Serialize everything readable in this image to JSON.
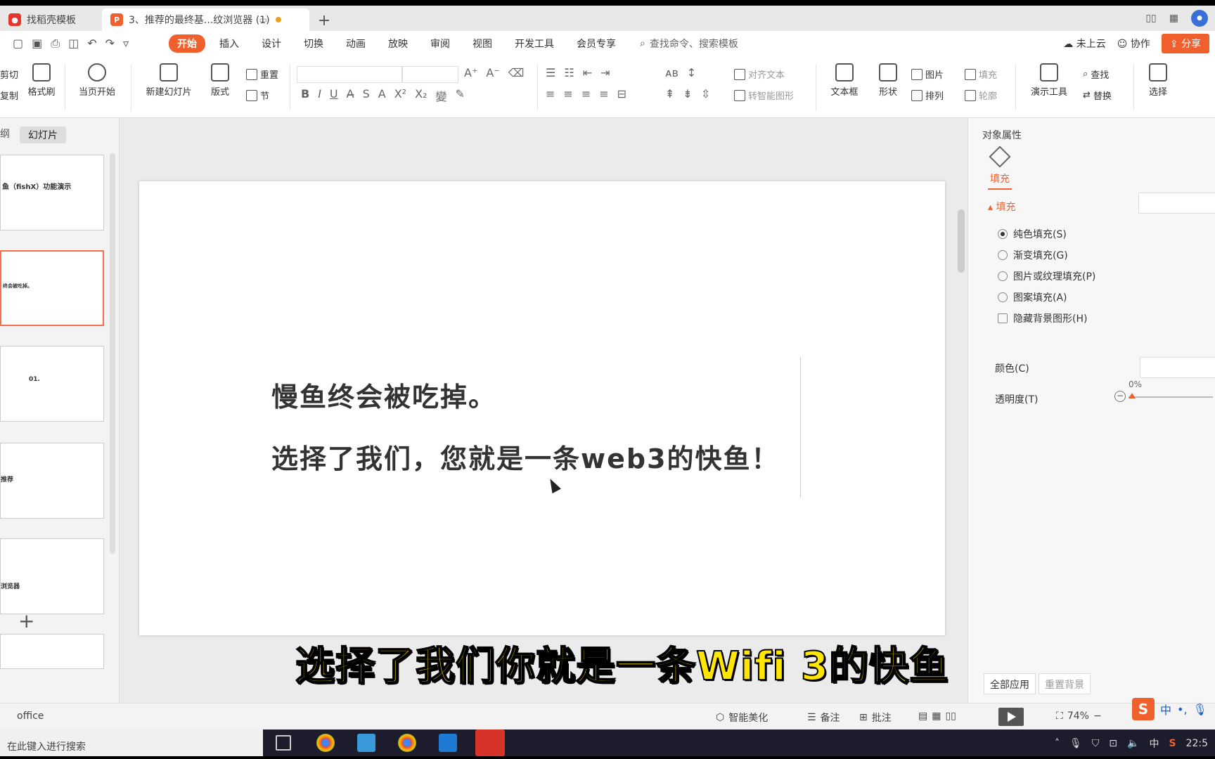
{
  "tabs": [
    {
      "label": "找稻壳模板"
    },
    {
      "label": "3、推荐的最终基...纹浏览器 (1)"
    }
  ],
  "menu": {
    "items": [
      "开始",
      "插入",
      "设计",
      "切换",
      "动画",
      "放映",
      "审阅",
      "视图",
      "开发工具",
      "会员专享"
    ],
    "search": "查找命令、搜索模板",
    "cloud": "未上云",
    "collab": "协作",
    "share": "分享"
  },
  "ribbon": {
    "cut": "剪切",
    "copy": "复制",
    "format_painter": "格式刷",
    "from_current": "当页开始",
    "new_slide": "新建幻灯片",
    "layout": "版式",
    "reset": "重置",
    "section": "节",
    "align_text": "对齐文本",
    "smart_art": "转智能图形",
    "textbox": "文本框",
    "shape": "形状",
    "picture": "图片",
    "arrange": "排列",
    "fill": "填充",
    "outline": "轮廓",
    "present_tool": "演示工具",
    "find": "查找",
    "replace": "替换",
    "select": "选择"
  },
  "left_panel": {
    "tab_outline": "纲",
    "tab_slides": "幻灯片",
    "thumbs": [
      {
        "text": "鱼（fishX）功能演示"
      },
      {
        "text": "终会被吃掉。"
      },
      {
        "text": "01."
      },
      {
        "text": "推荐"
      },
      {
        "text": "浏览器"
      }
    ]
  },
  "slide": {
    "line1": "慢鱼终会被吃掉。",
    "line2": "选择了我们，您就是一条web3的快鱼！"
  },
  "subtitle": "选择了我们你就是一条Wifi 3的快鱼",
  "right_panel": {
    "title": "对象属性",
    "fill_tab": "填充",
    "section": "填充",
    "options": [
      "纯色填充(S)",
      "渐变填充(G)",
      "图片或纹理填充(P)",
      "图案填充(A)"
    ],
    "hide_bg": "隐藏背景图形(H)",
    "color_label": "颜色(C)",
    "transparency_label": "透明度(T)",
    "transparency_value": "0%",
    "apply_all": "全部应用",
    "reset_bg": "重置背景"
  },
  "status": {
    "office": "office",
    "beautify": "智能美化",
    "notes": "备注",
    "comments": "批注",
    "zoom": "74%"
  },
  "taskbar": {
    "search": "在此键入进行搜索",
    "time": "22:5",
    "ime_lang": "中"
  },
  "colors": {
    "accent": "#f0602c",
    "subtitle": "#ffe600"
  }
}
